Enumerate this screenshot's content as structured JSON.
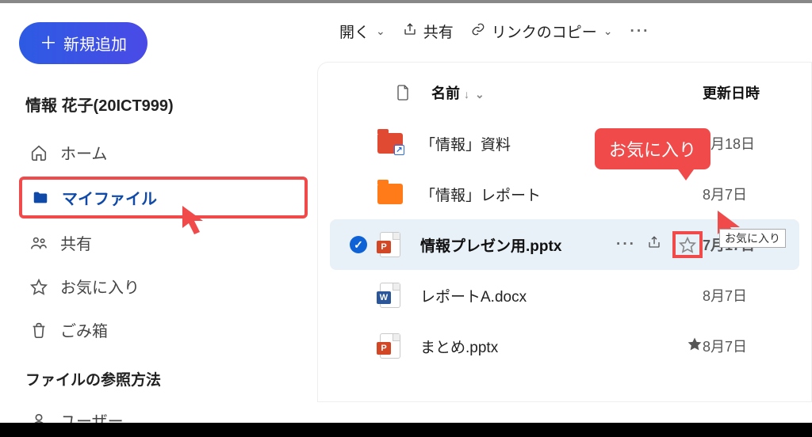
{
  "sidebar": {
    "new_button": "新規追加",
    "user_display": "情報 花子(20ICT999)",
    "nav": {
      "home": "ホーム",
      "my_files": "マイファイル",
      "shared": "共有",
      "favorites": "お気に入り",
      "trash": "ごみ箱"
    },
    "section_label": "ファイルの参照方法",
    "user_item": "ユーザー"
  },
  "toolbar": {
    "open": "開く",
    "share": "共有",
    "copy_link": "リンクのコピー"
  },
  "list_header": {
    "name": "名前",
    "modified": "更新日時"
  },
  "files": [
    {
      "name": "「情報」資料",
      "date": "7月18日"
    },
    {
      "name": "「情報」レポート",
      "date": "8月7日"
    },
    {
      "name": "情報プレゼン用.pptx",
      "date": "7月17日"
    },
    {
      "name": "レポートA.docx",
      "date": "8月7日"
    },
    {
      "name": "まとめ.pptx",
      "date": "8月7日"
    }
  ],
  "callout": "お気に入り",
  "native_tooltip": "お気に入り"
}
